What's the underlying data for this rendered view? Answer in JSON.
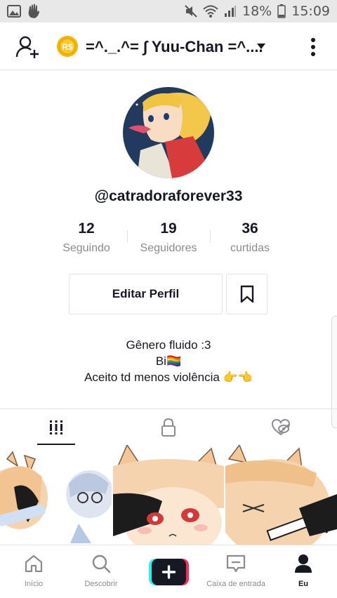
{
  "status_bar": {
    "battery_text": "18%",
    "time": "15:09",
    "icons": [
      "gallery-icon",
      "hand-icon",
      "mute-icon",
      "wifi-icon",
      "signal-icon",
      "battery-icon"
    ]
  },
  "header": {
    "account_name": "=^._.^= ∫ Yuu-Chan =^....",
    "coin_label": "R$"
  },
  "profile": {
    "username": "@catradoraforever33",
    "stats": [
      {
        "value": "12",
        "label": "Seguindo"
      },
      {
        "value": "19",
        "label": "Seguidores"
      },
      {
        "value": "36",
        "label": "curtidas"
      }
    ],
    "edit_button": "Editar Perfil",
    "bio": [
      "Gênero fluido :3",
      "Bi🏳️‍🌈",
      "Aceito td menos violência 👉👈"
    ]
  },
  "tabs": [
    {
      "icon": "grid-icon",
      "active": true
    },
    {
      "icon": "lock-icon",
      "active": false
    },
    {
      "icon": "liked-hidden-icon",
      "active": false
    }
  ],
  "bottom_nav": [
    {
      "label": "Início",
      "icon": "home-icon",
      "active": false
    },
    {
      "label": "Descobrir",
      "icon": "search-icon",
      "active": false
    },
    {
      "label": "",
      "icon": "plus-icon",
      "active": false
    },
    {
      "label": "Caixa de entrada",
      "icon": "inbox-icon",
      "active": false
    },
    {
      "label": "Eu",
      "icon": "profile-icon",
      "active": true
    }
  ],
  "colors": {
    "text": "#161823",
    "muted": "#8a8b91",
    "border": "#e3e3e4",
    "coin": "#f7b500",
    "accent_pink": "#fe2c55",
    "accent_cyan": "#25f4ee"
  }
}
